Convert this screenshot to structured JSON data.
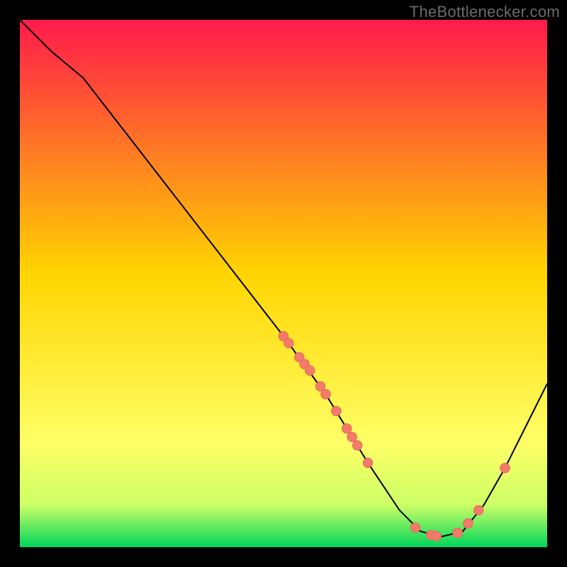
{
  "attribution": "TheBottlenecker.com",
  "chart_data": {
    "type": "line",
    "title": "",
    "xlabel": "",
    "ylabel": "",
    "xlim": [
      0,
      100
    ],
    "ylim": [
      0,
      100
    ],
    "grid": false,
    "colors": {
      "gradient_top": "#ff1a4b",
      "gradient_mid": "#ffd400",
      "gradient_low1": "#ffff66",
      "gradient_low2": "#ccff66",
      "gradient_bottom": "#00d65a",
      "line": "#000000",
      "point_fill": "#f47b6a",
      "point_stroke": "#e26b5c"
    },
    "curve": [
      {
        "x": 0,
        "y": 100
      },
      {
        "x": 3,
        "y": 97
      },
      {
        "x": 6,
        "y": 94
      },
      {
        "x": 9,
        "y": 91.5
      },
      {
        "x": 12,
        "y": 89
      },
      {
        "x": 50,
        "y": 40
      },
      {
        "x": 58,
        "y": 29
      },
      {
        "x": 66,
        "y": 16
      },
      {
        "x": 72,
        "y": 7
      },
      {
        "x": 76,
        "y": 3
      },
      {
        "x": 80,
        "y": 2
      },
      {
        "x": 84,
        "y": 3
      },
      {
        "x": 88,
        "y": 8
      },
      {
        "x": 92,
        "y": 15
      },
      {
        "x": 96,
        "y": 23
      },
      {
        "x": 100,
        "y": 31
      }
    ],
    "points": [
      {
        "x": 50,
        "y": 40
      },
      {
        "x": 51,
        "y": 38.7
      },
      {
        "x": 53,
        "y": 36
      },
      {
        "x": 54,
        "y": 34.7
      },
      {
        "x": 55,
        "y": 33.5
      },
      {
        "x": 57,
        "y": 30.5
      },
      {
        "x": 58,
        "y": 29
      },
      {
        "x": 60,
        "y": 25.8
      },
      {
        "x": 62,
        "y": 22.5
      },
      {
        "x": 63,
        "y": 20.9
      },
      {
        "x": 64,
        "y": 19.3
      },
      {
        "x": 66,
        "y": 16
      },
      {
        "x": 75,
        "y": 3.7
      },
      {
        "x": 78,
        "y": 2.3
      },
      {
        "x": 79,
        "y": 2.1
      },
      {
        "x": 83,
        "y": 2.7
      },
      {
        "x": 85,
        "y": 4.5
      },
      {
        "x": 87,
        "y": 7
      },
      {
        "x": 92,
        "y": 15
      }
    ]
  }
}
